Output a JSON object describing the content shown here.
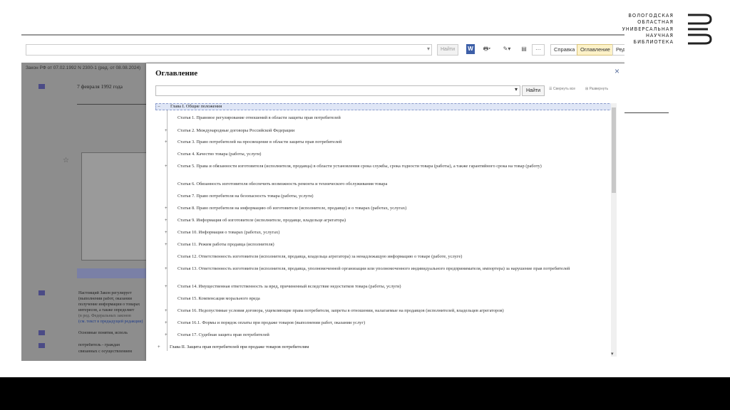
{
  "logo": {
    "lines": [
      "ВОЛОГОДСКАЯ",
      "ОБЛАСТНАЯ",
      "УНИВЕРСАЛЬНАЯ",
      "НАУЧНАЯ",
      "БИБЛИОТЕКА"
    ],
    "color": "#222222"
  },
  "toolbar": {
    "find_label": "Найти",
    "tabs": [
      "Справка",
      "Оглавление",
      "Ред"
    ],
    "active_tab": "Оглавление",
    "icons": [
      "word-icon",
      "print-icon",
      "bookmark-icon",
      "comment-icon",
      "more-icon"
    ]
  },
  "document": {
    "header": "Закон РФ от 07.02.1992 N 2300-1 (ред. от 08.08.2024)",
    "date": "7 февраля 1992 года",
    "paragraphs": [
      "Настоящий Закон регулирует",
      "(выполнении работ, оказании",
      "получение информации о товарах",
      "интересов, а также определяет",
      "(в ред. Федеральных законов",
      "(см. текст в предыдущей редакции)",
      "Основные понятия, исполь",
      "потребитель - граждан",
      "связанных с осуществлением"
    ]
  },
  "dialog": {
    "title": "Оглавление",
    "find_label": "Найти",
    "collapse_label": "Свернуть все",
    "expand_label": "Развернуть",
    "close_glyph": "×",
    "toc": [
      "Глава I. Общие положения",
      "Статья 1. Правовое регулирование отношений в области защиты прав потребителей",
      "Статья 2. Международные договоры Российской Федерации",
      "Статья 3. Право потребителей на просвещение в области защиты прав потребителей",
      "Статья 4. Качество товара (работы, услуги)",
      "Статья 5. Права и обязанности изготовителя (исполнителя, продавца) в области установления срока службы, срока годности товара (работы), а также гарантийного срока на товар (работу)",
      "Статья 6. Обязанность изготовителя обеспечить возможность ремонта и технического обслуживания товара",
      "Статья 7. Право потребителя на безопасность товара (работы, услуги)",
      "Статья 8. Право потребителя на информацию об изготовителе (исполнителе, продавце) и о товарах (работах, услугах)",
      "Статья 9. Информация об изготовителе (исполнителе, продавце, владельце агрегатора)",
      "Статья 10. Информация о товарах (работах, услугах)",
      "Статья 11. Режим работы продавца (исполнителя)",
      "Статья 12. Ответственность изготовителя (исполнителя, продавца, владельца агрегатора) за ненадлежащую информацию о товаре (работе, услуге)",
      "Статья 13. Ответственность изготовителя (исполнителя, продавца, уполномоченной организации или уполномоченного индивидуального предпринимателя, импортера) за нарушение прав потребителей",
      "Статья 14. Имущественная ответственность за вред, причиненный вследствие недостатков товара (работы, услуги)",
      "Статья 15. Компенсация морального вреда",
      "Статья 16. Недопустимые условия договора, ущемляющие права потребителя, запреты в отношении, налагаемые на продавцов (исполнителей, владельцев агрегаторов)",
      "Статья 16.1. Формы и порядок оплаты при продаже товаров (выполнении работ, оказании услуг)",
      "Статья 17. Судебная защита прав потребителей",
      "Глава II. Защита прав потребителей при продаже товаров потребителям"
    ]
  }
}
